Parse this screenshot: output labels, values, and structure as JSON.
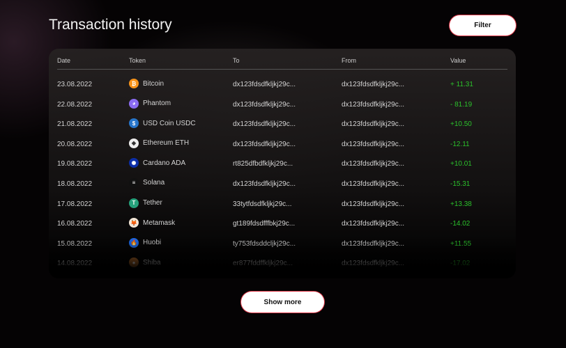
{
  "title": "Transaction history",
  "filter_label": "Filter",
  "show_more_label": "Show more",
  "headers": [
    "Date",
    "Token",
    "To",
    "From",
    "Value"
  ],
  "rows": [
    {
      "date": "23.08.2022",
      "token": "Bitcoin",
      "icon": "bitcoin-icon",
      "color": "#f7931a",
      "glyph": "₿",
      "to": "dx123fdsdfkljkj29c...",
      "from": "dx123fdsdfkljkj29c...",
      "value": "+ 11.31"
    },
    {
      "date": "22.08.2022",
      "token": "Phantom",
      "icon": "phantom-icon",
      "color": "#8a6cf0",
      "glyph": "◕",
      "to": "dx123fdsdfkljkj29c...",
      "from": "dx123fdsdfkljkj29c...",
      "value": "- 81.19"
    },
    {
      "date": "21.08.2022",
      "token": "USD Coin USDC",
      "icon": "usdc-icon",
      "color": "#2775ca",
      "glyph": "$",
      "to": "dx123fdsdfkljkj29c...",
      "from": "dx123fdsdfkljkj29c...",
      "value": "+10.50"
    },
    {
      "date": "20.08.2022",
      "token": "Ethereum ETH",
      "icon": "ethereum-icon",
      "color": "#eeeeee",
      "glyph": "◆",
      "to": "dx123fdsdfkljkj29c...",
      "from": "dx123fdsdfkljkj29c...",
      "value": "-12.11"
    },
    {
      "date": "19.08.2022",
      "token": "Cardano ADA",
      "icon": "cardano-icon",
      "color": "#0d2fa8",
      "glyph": "✺",
      "to": "rt825dfbdfkljkj29c...",
      "from": "dx123fdsdfkljkj29c...",
      "value": "+10.01"
    },
    {
      "date": "18.08.2022",
      "token": "Solana",
      "icon": "solana-icon",
      "color": "#111111",
      "glyph": "≡",
      "to": "dx123fdsdfkljkj29c...",
      "from": "dx123fdsdfkljkj29c...",
      "value": "-15.31"
    },
    {
      "date": "17.08.2022",
      "token": "Tether",
      "icon": "tether-icon",
      "color": "#26a17b",
      "glyph": "T",
      "to": "33tytfdsdfkljkj29c...",
      "from": "dx123fdsdfkljkj29c...",
      "value": "+13.38"
    },
    {
      "date": "16.08.2022",
      "token": "Metamask",
      "icon": "metamask-icon",
      "color": "#f3e6d6",
      "glyph": "🦊",
      "to": "gt189fdsdfffbkj29c...",
      "from": "dx123fdsdfkljkj29c...",
      "value": "-14.02"
    },
    {
      "date": "15.08.2022",
      "token": "Huobi",
      "icon": "huobi-icon",
      "color": "#1e6ef0",
      "glyph": "🔥",
      "to": "ty753fdsddcljkj29c...",
      "from": "dx123fdsdfkljkj29c...",
      "value": "+11.55"
    },
    {
      "date": "14.08.2022",
      "token": "Shiba",
      "icon": "shiba-icon",
      "color": "#b06a2a",
      "glyph": "●",
      "to": "er877fddffkljkj29c...",
      "from": "dx123fdsdfkljkj29c...",
      "value": "-17.02"
    }
  ]
}
